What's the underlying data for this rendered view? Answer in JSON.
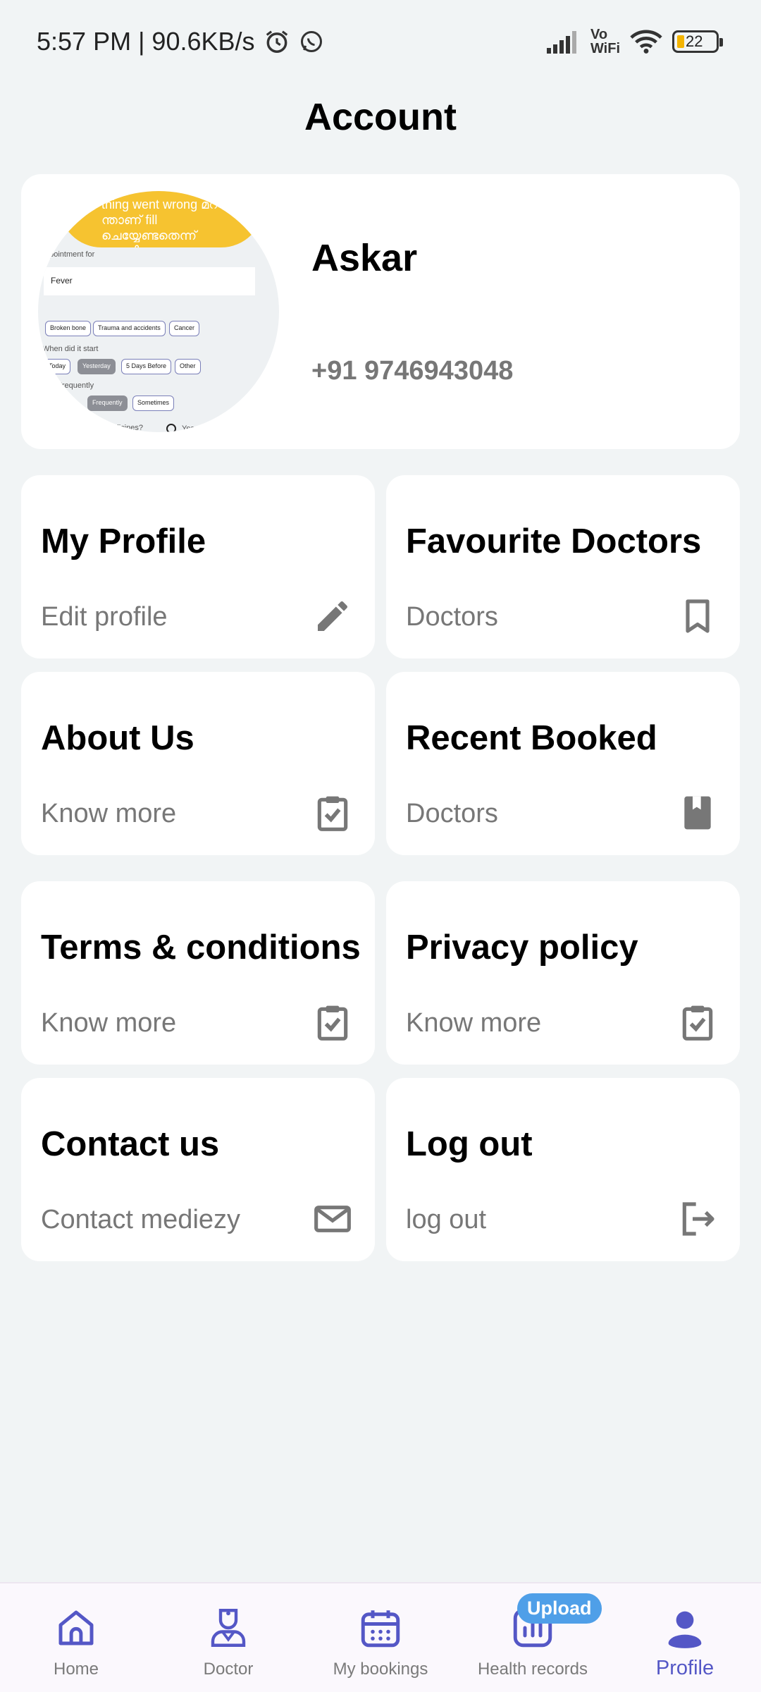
{
  "status_bar": {
    "time_speed": "5:57 PM | 90.6KB/s",
    "vowifi_top": "Vo",
    "vowifi_bottom": "WiFi",
    "battery": "22"
  },
  "header": {
    "title": "Account"
  },
  "profile": {
    "name": "Askar",
    "phone": "+91 9746943048",
    "avatar_preview": {
      "banner": "thing went wrong മറ ന്താണ് fill ചെയ്യേണ്ടതെന്ന് കാണിക്കണം",
      "section_label": "ppointment for",
      "field_value": "Fever",
      "chips_row1": [
        "Broken bone",
        "Trauma and accidents",
        "Cancer"
      ],
      "when_label": "When did it start",
      "chips_row2": [
        "Today",
        "Yesterday",
        "5 Days Before",
        "Other"
      ],
      "freq_label": "ow Frequently",
      "chips_row3": [
        "inues",
        "Frequently",
        "Sometimes"
      ],
      "medicine_label": "regular medicines?",
      "yes_label": "Yes"
    }
  },
  "cards": [
    {
      "title": "My Profile",
      "subtitle": "Edit profile",
      "icon": "pencil-icon"
    },
    {
      "title": "Favourite Doctors",
      "subtitle": "Doctors",
      "icon": "bookmark-icon"
    },
    {
      "title": "About Us",
      "subtitle": "Know more",
      "icon": "clipboard-check-icon"
    },
    {
      "title": "Recent Booked",
      "subtitle": "Doctors",
      "icon": "book-icon"
    },
    {
      "title": "Terms & conditions",
      "subtitle": "Know more",
      "icon": "clipboard-check-icon"
    },
    {
      "title": "Privacy policy",
      "subtitle": "Know more",
      "icon": "clipboard-check-icon"
    },
    {
      "title": "Contact us",
      "subtitle": "Contact mediezy",
      "icon": "mail-icon"
    },
    {
      "title": "Log out",
      "subtitle": "log out",
      "icon": "logout-icon"
    }
  ],
  "bottom_nav": {
    "items": [
      {
        "label": "Home",
        "icon": "home-icon"
      },
      {
        "label": "Doctor",
        "icon": "doctor-icon"
      },
      {
        "label": "My bookings",
        "icon": "calendar-icon"
      },
      {
        "label": "Health records",
        "icon": "chart-icon"
      },
      {
        "label": "Profile",
        "icon": "person-icon"
      }
    ],
    "active": "Profile",
    "upload_badge": "Upload"
  },
  "colors": {
    "accent": "#5457c6",
    "icon_gray": "#777777",
    "badge": "#4f9fe8",
    "background": "#f1f4f5"
  }
}
